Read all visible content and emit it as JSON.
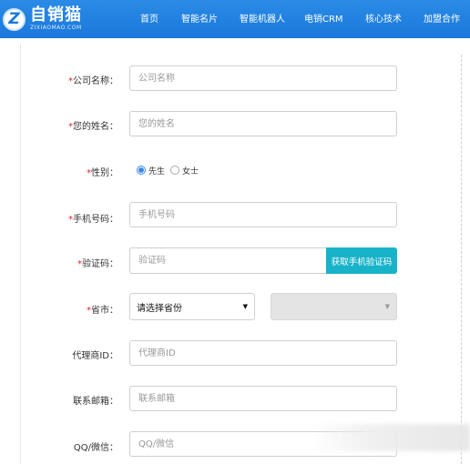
{
  "brand": {
    "name_cn": "自销猫",
    "name_en": "ZIXIAOMAO.COM",
    "logo_glyph": "Z",
    "color": "#1a78db"
  },
  "nav": {
    "items": [
      {
        "label": "首页"
      },
      {
        "label": "智能名片"
      },
      {
        "label": "智能机器人"
      },
      {
        "label": "电销CRM"
      },
      {
        "label": "核心技术"
      },
      {
        "label": "加盟合作"
      }
    ]
  },
  "form": {
    "company": {
      "label": "公司名称：",
      "placeholder": "公司名称",
      "required_mark": "*"
    },
    "name": {
      "label": "您的姓名：",
      "placeholder": "您的姓名",
      "required_mark": "*"
    },
    "gender": {
      "label": "性别：",
      "required_mark": "*",
      "options": [
        "先生",
        "女士"
      ],
      "selected": "先生"
    },
    "phone": {
      "label": "手机号码：",
      "placeholder": "手机号码",
      "required_mark": "*"
    },
    "captcha": {
      "label": "验证码：",
      "placeholder": "验证码",
      "required_mark": "*",
      "button": "获取手机验证码",
      "button_color": "#19b3c9"
    },
    "region": {
      "label": "省市：",
      "required_mark": "*",
      "province_value": "请选择省份",
      "province_caret": "▼",
      "city_caret": "▼"
    },
    "agent_id": {
      "label": "代理商ID：",
      "placeholder": "代理商ID"
    },
    "email": {
      "label": "联系邮箱：",
      "placeholder": "联系邮箱"
    },
    "qq": {
      "label": "QQ/微信：",
      "placeholder": "QQ/微信"
    }
  }
}
